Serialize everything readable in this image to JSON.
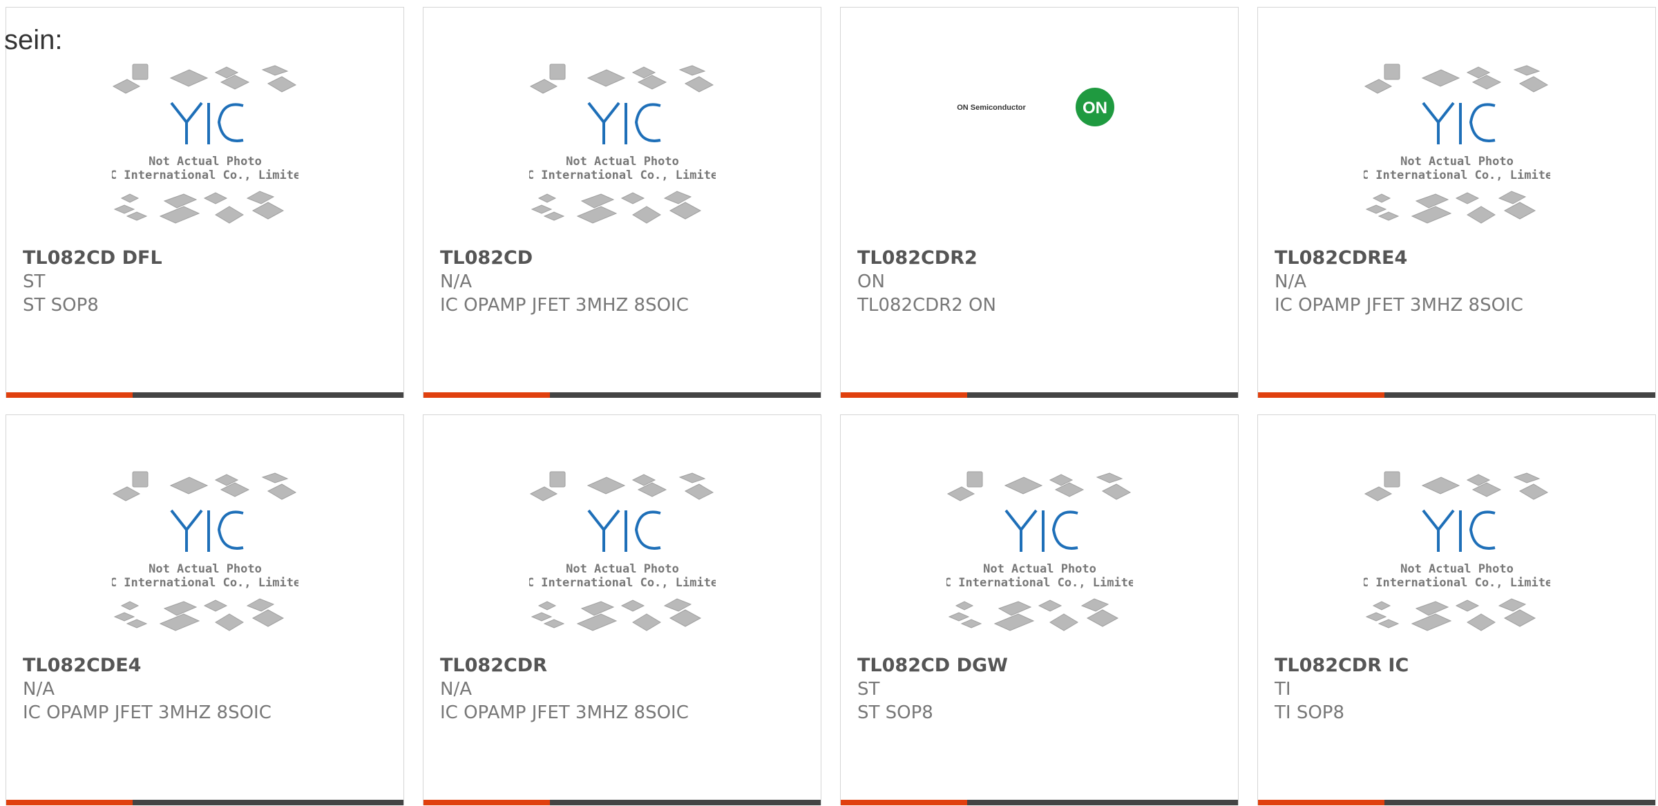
{
  "page": {
    "prefix_text": "sein:"
  },
  "colors": {
    "accent": "#e0400e",
    "bar": "#444444",
    "yic_blue": "#1e6fb8",
    "on_green": "#1f9a40"
  },
  "placeholder_image": {
    "line1": "Not Actual Photo",
    "line2": "YIC International Co., Limited.",
    "logo_text": "YIC"
  },
  "on_logo": {
    "brand": "ON Semiconductor",
    "mark": "ON"
  },
  "cards": [
    {
      "part": "TL082CD DFL",
      "manufacturer": "ST",
      "description": "ST SOP8",
      "image": "yic-placeholder"
    },
    {
      "part": "TL082CD",
      "manufacturer": "N/A",
      "description": "IC OPAMP JFET 3MHZ 8SOIC",
      "image": "yic-placeholder"
    },
    {
      "part": "TL082CDR2",
      "manufacturer": "ON",
      "description": "TL082CDR2 ON",
      "image": "on-semiconductor-logo"
    },
    {
      "part": "TL082CDRE4",
      "manufacturer": "N/A",
      "description": "IC OPAMP JFET 3MHZ 8SOIC",
      "image": "yic-placeholder"
    },
    {
      "part": "TL082CDE4",
      "manufacturer": "N/A",
      "description": "IC OPAMP JFET 3MHZ 8SOIC",
      "image": "yic-placeholder"
    },
    {
      "part": "TL082CDR",
      "manufacturer": "N/A",
      "description": "IC OPAMP JFET 3MHZ 8SOIC",
      "image": "yic-placeholder"
    },
    {
      "part": "TL082CD DGW",
      "manufacturer": "ST",
      "description": "ST SOP8",
      "image": "yic-placeholder"
    },
    {
      "part": "TL082CDR IC",
      "manufacturer": "TI",
      "description": "TI SOP8",
      "image": "yic-placeholder"
    }
  ]
}
